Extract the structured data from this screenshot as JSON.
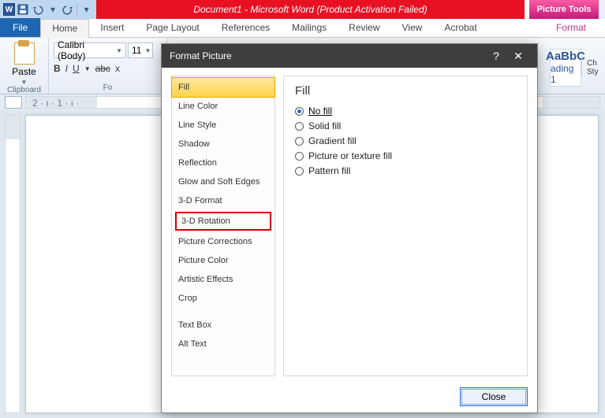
{
  "titlebar": {
    "doc_title": "Document1  -  Microsoft Word (Product Activation Failed)",
    "picture_tools": "Picture Tools",
    "qat": {
      "word_letter": "W",
      "save": "save-icon",
      "undo": "undo-icon",
      "redo": "redo-icon"
    }
  },
  "tabs": {
    "file": "File",
    "items": [
      "Home",
      "Insert",
      "Page Layout",
      "References",
      "Mailings",
      "Review",
      "View",
      "Acrobat"
    ],
    "context_format": "Format",
    "active": "Home"
  },
  "ribbon": {
    "clipboard_label": "Clipboard",
    "paste": "Paste",
    "font_group_label": "Fo",
    "font_name": "Calibri (Body)",
    "font_size": "11",
    "bold": "B",
    "italic": "I",
    "underline": "U",
    "strike": "abc",
    "sub": "x",
    "style_preview": "AaBbC",
    "style_name": "ading 1",
    "edit_col": [
      "Ch",
      "Sty"
    ]
  },
  "ruler": {
    "text_l": "2 · ı · 1 · ı ·",
    "text_r": "· ı ·"
  },
  "dialog": {
    "title": "Format Picture",
    "help": "?",
    "close_x": "✕",
    "categories": [
      {
        "label": "Fill",
        "sel": true
      },
      {
        "label": "Line Color"
      },
      {
        "label": "Line Style"
      },
      {
        "label": "Shadow"
      },
      {
        "label": "Reflection"
      },
      {
        "label": "Glow and Soft Edges"
      },
      {
        "label": "3-D Format"
      },
      {
        "label": "3-D Rotation",
        "highlight": true
      },
      {
        "label": "Picture Corrections"
      },
      {
        "label": "Picture Color"
      },
      {
        "label": "Artistic Effects"
      },
      {
        "label": "Crop"
      },
      {
        "label": "Text Box",
        "spaced": true
      },
      {
        "label": "Alt Text"
      }
    ],
    "pane_heading": "Fill",
    "fill_options": [
      {
        "label": "No fill",
        "sel": true
      },
      {
        "label": "Solid fill"
      },
      {
        "label": "Gradient fill"
      },
      {
        "label": "Picture or texture fill"
      },
      {
        "label": "Pattern fill"
      }
    ],
    "close_btn": "Close"
  }
}
